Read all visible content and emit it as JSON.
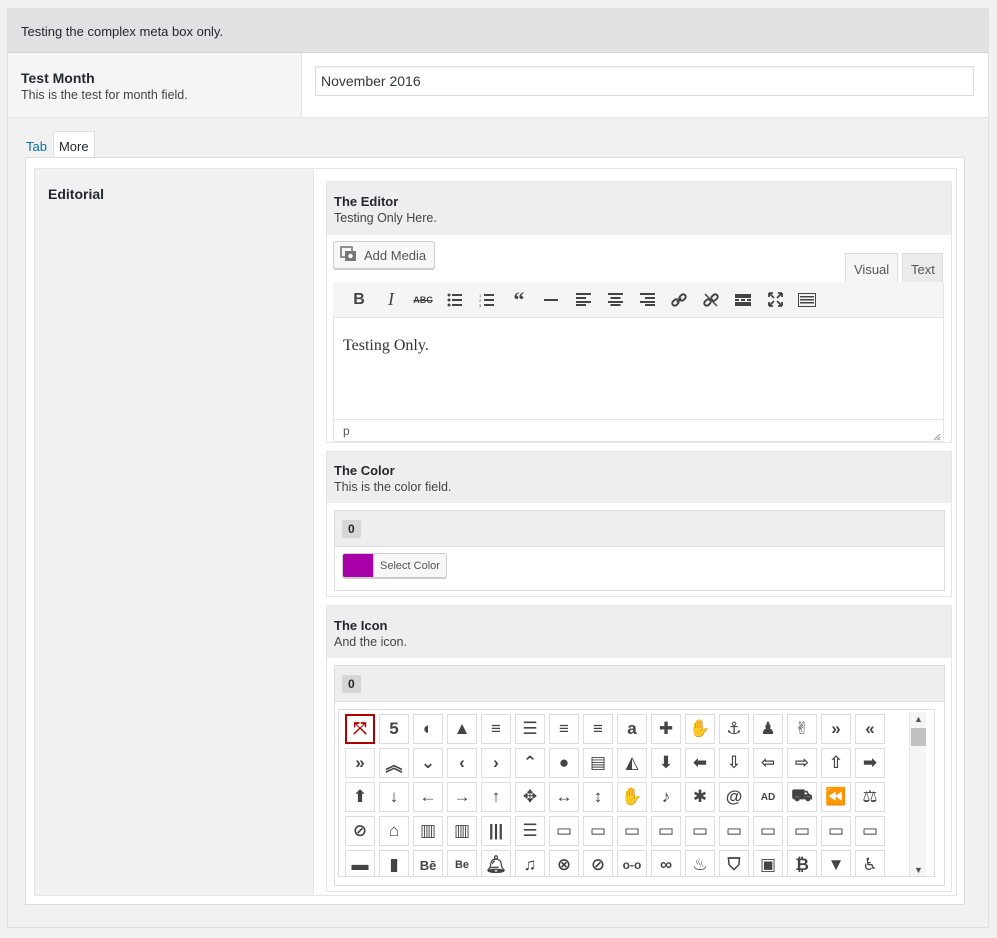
{
  "intro": "Testing the complex meta box only.",
  "month": {
    "label": "Test Month",
    "description": "This is the test for month field.",
    "value": "November 2016"
  },
  "tabs": [
    {
      "label": "Tab",
      "active": false
    },
    {
      "label": "More",
      "active": true
    }
  ],
  "editorial": {
    "label": "Editorial",
    "editor": {
      "label": "The Editor",
      "description": "Testing Only Here.",
      "add_media": "Add Media",
      "tab_visual": "Visual",
      "tab_text": "Text",
      "content": "Testing Only.",
      "status": "p",
      "toolbar": [
        "bold-icon",
        "italic-icon",
        "strikethrough-icon",
        "bullet-list-icon",
        "numbered-list-icon",
        "blockquote-icon",
        "horizontal-rule-icon",
        "align-left-icon",
        "align-center-icon",
        "align-right-icon",
        "link-icon",
        "unlink-icon",
        "read-more-icon",
        "fullscreen-icon",
        "toolbar-toggle-icon"
      ]
    },
    "color": {
      "label": "The Color",
      "description": "This is the color field.",
      "index": "0",
      "select_label": "Select Color",
      "swatch": "#a800a8"
    },
    "icon": {
      "label": "The Icon",
      "description": "And the icon.",
      "index": "0",
      "selected": "expand-arrows-icon"
    }
  }
}
